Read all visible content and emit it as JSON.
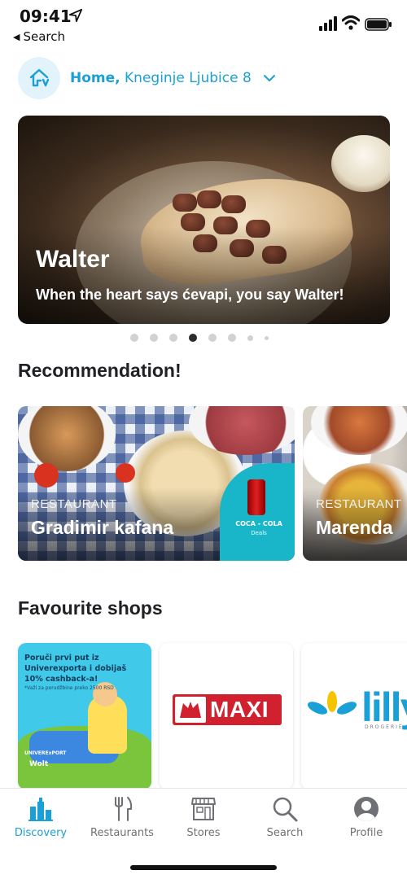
{
  "status": {
    "time": "09:41",
    "back_label": "Search"
  },
  "address": {
    "label": "Home,",
    "street": "Kneginje Ljubice 8"
  },
  "hero": {
    "title": "Walter",
    "subtitle": "When the heart says ćevapi, you say Walter!",
    "page_count": 8,
    "active_index": 3
  },
  "recommendation": {
    "title": "Recommendation!",
    "cards": [
      {
        "category": "RESTAURANT",
        "name": "Gradimir kafana",
        "badge": "COCA - COLA",
        "badge_sub": "Deals"
      },
      {
        "category": "RESTAURANT",
        "name": "Marenda"
      }
    ]
  },
  "favourites": {
    "title": "Favourite shops",
    "promo": {
      "text": "Poruči prvi put iz Univerexporta i dobijaš 10% cashback-a!",
      "fine": "*Važi za porudžbine preko 2500 RSD",
      "brand": "UNIVERExPORT",
      "partner": "Wolt"
    },
    "maxi": {
      "name": "MAXI"
    },
    "lilly": {
      "name": "lilly",
      "sub": "DROGERIE"
    }
  },
  "tabs": [
    {
      "label": "Discovery",
      "icon": "discovery-icon",
      "active": true
    },
    {
      "label": "Restaurants",
      "icon": "fork-knife-icon",
      "active": false
    },
    {
      "label": "Stores",
      "icon": "store-icon",
      "active": false
    },
    {
      "label": "Search",
      "icon": "search-icon",
      "active": false
    },
    {
      "label": "Profile",
      "icon": "profile-icon",
      "active": false
    }
  ],
  "colors": {
    "accent": "#1aa0d6",
    "text": "#202125",
    "muted": "#6f7075"
  }
}
